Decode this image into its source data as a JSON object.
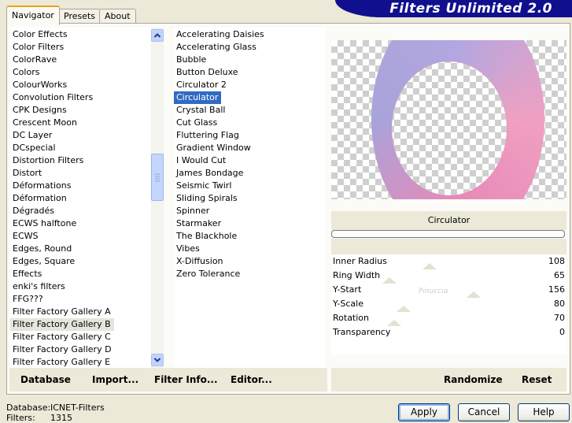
{
  "tabs": [
    "Navigator",
    "Presets",
    "About"
  ],
  "banner_title": "Filters Unlimited 2.0",
  "categories": [
    "Color Effects",
    "Color Filters",
    "ColorRave",
    "Colors",
    "ColourWorks",
    "Convolution Filters",
    "CPK Designs",
    "Crescent Moon",
    "DC Layer",
    "DCspecial",
    "Distortion Filters",
    "Distort",
    "Déformations",
    "Déformation",
    "Dégradés",
    "ECWS halftone",
    "ECWS",
    "Edges, Round",
    "Edges, Square",
    "Effects",
    "enki's filters",
    "FFG???",
    "Filter Factory Gallery A",
    "Filter Factory Gallery B",
    "Filter Factory Gallery C",
    "Filter Factory Gallery D",
    "Filter Factory Gallery E"
  ],
  "selected_category": "Filter Factory Gallery B",
  "filters": [
    "Accelerating Daisies",
    "Accelerating Glass",
    "Bubble",
    "Button Deluxe",
    "Circulator 2",
    "Circulator",
    "Crystal Ball",
    "Cut Glass",
    "Fluttering Flag",
    "Gradient Window",
    "I Would Cut",
    "James Bondage",
    "Seismic Twirl",
    "Sliding Spirals",
    "Spinner",
    "Starmaker",
    "The Blackhole",
    "Vibes",
    "X-Diffusion",
    "Zero Tolerance"
  ],
  "selected_filter": "Circulator",
  "bottom_buttons": {
    "database": "Database",
    "import": "Import...",
    "filter_info": "Filter Info...",
    "editor": "Editor..."
  },
  "filter_name": "Circulator",
  "params": [
    {
      "name": "Inner Radius",
      "value": "108",
      "level": 0.42
    },
    {
      "name": "Ring Width",
      "value": "65",
      "level": 0.25
    },
    {
      "name": "Y-Start",
      "value": "156",
      "level": 0.61
    },
    {
      "name": "Y-Scale",
      "value": "80",
      "level": 0.31
    },
    {
      "name": "Rotation",
      "value": "70",
      "level": 0.27
    },
    {
      "name": "Transparency",
      "value": "0",
      "level": 0
    }
  ],
  "right_buttons": {
    "randomize": "Randomize",
    "reset": "Reset"
  },
  "status": {
    "database_label": "Database:",
    "database_value": "ICNET-Filters",
    "filters_label": "Filters:",
    "filters_value": "1315"
  },
  "dialog_buttons": {
    "apply": "Apply",
    "cancel": "Cancel",
    "help": "Help"
  },
  "watermark": "Pinuccia",
  "colors": {
    "banner": "#10108e",
    "selection": "#316ac5",
    "tab_highlight": "#e8a317"
  }
}
